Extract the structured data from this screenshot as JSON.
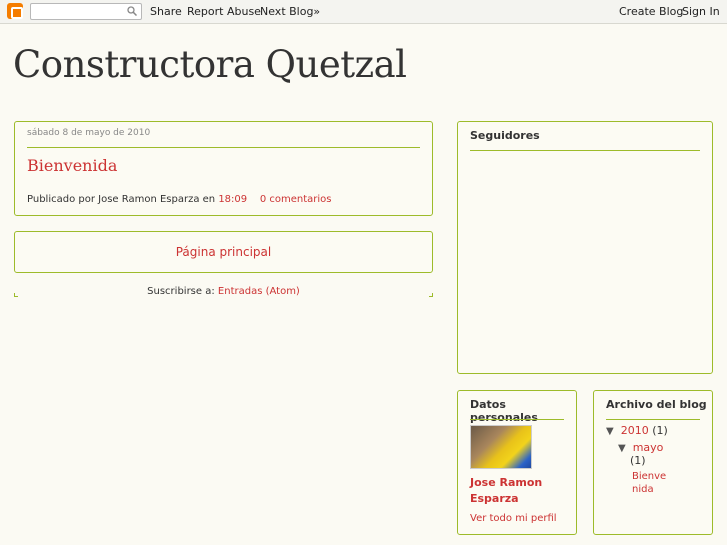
{
  "navbar": {
    "share": "Share",
    "report_abuse": "Report Abuse",
    "next_blog": "Next Blog»",
    "create_blog": "Create Blog",
    "sign_in": "Sign In",
    "search_placeholder": ""
  },
  "blog": {
    "title": "Constructora Quetzal"
  },
  "post": {
    "date": "sábado 8 de mayo de 2010",
    "title": "Bienvenida",
    "published_by": "Publicado por Jose Ramon Esparza en",
    "time": "18:09",
    "comments": "0 comentarios"
  },
  "home_link": "Página principal",
  "subscribe": {
    "label": "Suscribirse a:",
    "link": "Entradas (Atom)"
  },
  "followers": {
    "title": "Seguidores"
  },
  "profile": {
    "title": "Datos personales",
    "name": "Jose Ramon Esparza",
    "view_profile": "Ver todo mi perfil"
  },
  "archive": {
    "title": "Archivo del blog",
    "year": "2010",
    "year_count": "(1)",
    "month": "mayo",
    "month_count": "(1)",
    "post": "Bienvenida"
  },
  "colors": {
    "accent_red": "#cc3333",
    "border_green": "#9dbb2a",
    "background": "#fbfaf3"
  },
  "icons": {
    "logo": "blogger-icon",
    "search": "search-icon",
    "expand": "triangle-down-icon"
  }
}
